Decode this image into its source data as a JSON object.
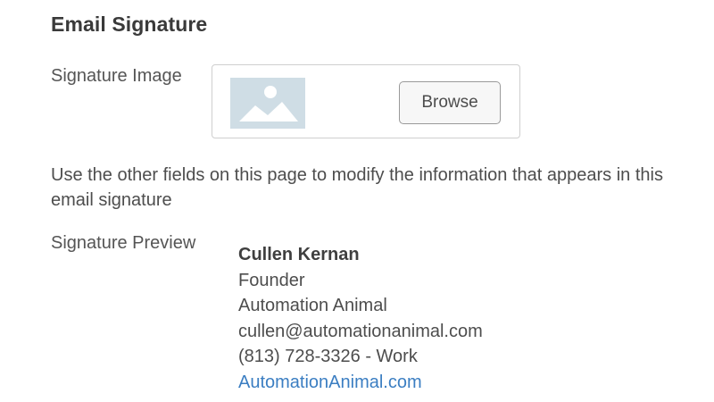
{
  "section": {
    "title": "Email Signature"
  },
  "signature_image": {
    "label": "Signature Image",
    "placeholder_icon": "image-placeholder-icon",
    "browse_label": "Browse"
  },
  "help_text": "Use the other fields on this page to modify the information that appears in this email signature",
  "preview": {
    "label": "Signature Preview",
    "name": "Cullen Kernan",
    "title": "Founder",
    "company": "Automation Animal",
    "email": "cullen@automationanimal.com",
    "phone": "(813) 728-3326 - Work",
    "website": "AutomationAnimal.com"
  },
  "colors": {
    "link": "#3b7ec2",
    "placeholder_bg": "#cfdde5",
    "placeholder_fg": "#ffffff"
  }
}
